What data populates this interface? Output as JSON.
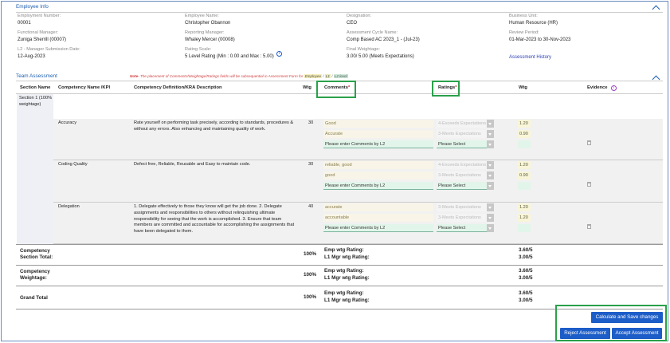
{
  "employee_info": {
    "title": "Employee Info",
    "fields": [
      {
        "label": "Employment Number:",
        "value": "00001"
      },
      {
        "label": "Employee Name:",
        "value": "Christopher Obannon"
      },
      {
        "label": "Designation:",
        "value": "CEO"
      },
      {
        "label": "Business Unit:",
        "value": "Human Resource (HR)"
      },
      {
        "label": "Functional Manager:",
        "value": "Zuniga Sherrill (00007)"
      },
      {
        "label": "Reporting Manager:",
        "value": "Whaley Mercer (00008)"
      },
      {
        "label": "Assessment Cycle Name:",
        "value": "Comp Based AC 2023_1 - (Jul-23)"
      },
      {
        "label": "Review Period:",
        "value": "01-Mar-2023 to 30-Nov-2023"
      },
      {
        "label": "L2 - Manager Submission Date:",
        "value": "12-Aug-2023"
      },
      {
        "label": "Rating Scale:",
        "value": "5 Level Rating (Min : 0.00 and Max : 5.00)"
      },
      {
        "label": "Final Weightage:",
        "value": "3.00/ 5.00 (Meets Expectations)"
      }
    ],
    "history_link": "Assessment History"
  },
  "team": {
    "title": "Team Assessment",
    "note_prefix": "Note-",
    "note_text": " The placement of Comments/Weightage/Ratings fields will be subsequential in Assessment Form for ",
    "note_employee": "Employee",
    "note_l1": "L1",
    "note_l2": "L2 level",
    "columns": [
      "Section Name",
      "Competency Name /KPI",
      "Competency Definition/KRA Description",
      "Wtg",
      "Comments",
      "Ratings",
      "Wtg",
      "Evidence"
    ],
    "required_mark": "*",
    "section": "Section 1 (100% weightage)",
    "rows": [
      {
        "name": "Accuracy",
        "description": "Rate yourself on performing task precisely, according to standards, procedures & without any errors. Also enhancing and maintaining quality of work.",
        "wtg": "30",
        "c1": "Good",
        "c2": "Accurate",
        "c3": "Please enter Comments by L2",
        "r1": "4-Exceeds Expectations",
        "r2": "3-Meets Expectations",
        "r3": "Please Select",
        "w1": "1.20",
        "w2": "0.90"
      },
      {
        "name": "Coding Quality",
        "description": "Defect free, Reliable, Reusable and Easy to maintain code.",
        "wtg": "30",
        "c1": "reliable, good",
        "c2": "good",
        "c3": "Please enter Comments by L2",
        "r1": "4-Exceeds Expectations",
        "r2": "3-Meets Expectations",
        "r3": "Please Select",
        "w1": "1.20",
        "w2": "0.90"
      },
      {
        "name": "Delegation",
        "description": "1. Delegate effectively to those they know will get the job done. 2. Delegate assignments and responsibilities to others without relinquishing ultimate responsibility for seeing that the work is accomplished. 3. Ensure that team members are committed and accountable for accomplishing the assignments that have been delegated to them.",
        "wtg": "40",
        "c1": "accurate",
        "c2": "accountable",
        "c3": "Please enter Comments by L2",
        "r1": "3-Meets Expectations",
        "r2": "3-Meets Expectations",
        "r3": "Please Select",
        "w1": "1.20",
        "w2": "1.20"
      }
    ],
    "totals": [
      {
        "label1": "Competency",
        "label2": "Section Total:",
        "pct": "100%",
        "emp": "Emp wtg Rating:",
        "l1": "L1 Mgr wtg Rating:",
        "emp_val": "3.60/5",
        "l1_val": "3.00/5"
      },
      {
        "label1": "Competency",
        "label2": "Weightage:",
        "pct": "100%",
        "emp": "Emp wtg Rating:",
        "l1": "L1 Mgr wtg Rating:",
        "emp_val": "3.60/5",
        "l1_val": "3.00/5"
      },
      {
        "label1": "Grand Total",
        "label2": "",
        "pct": "100%",
        "emp": "Emp wtg Rating:",
        "l1": "L1 Mgr wtg Rating:",
        "emp_val": "3.60/5",
        "l1_val": "3.00/5"
      }
    ]
  },
  "buttons": {
    "calculate": "Calculate and Save changes",
    "reject": "Reject Assessment",
    "accept": "Accept Assessment"
  },
  "colors": {
    "accent": "#1d5dc8",
    "highlight": "#2aa04a",
    "header_blue": "#1f5fb0"
  }
}
